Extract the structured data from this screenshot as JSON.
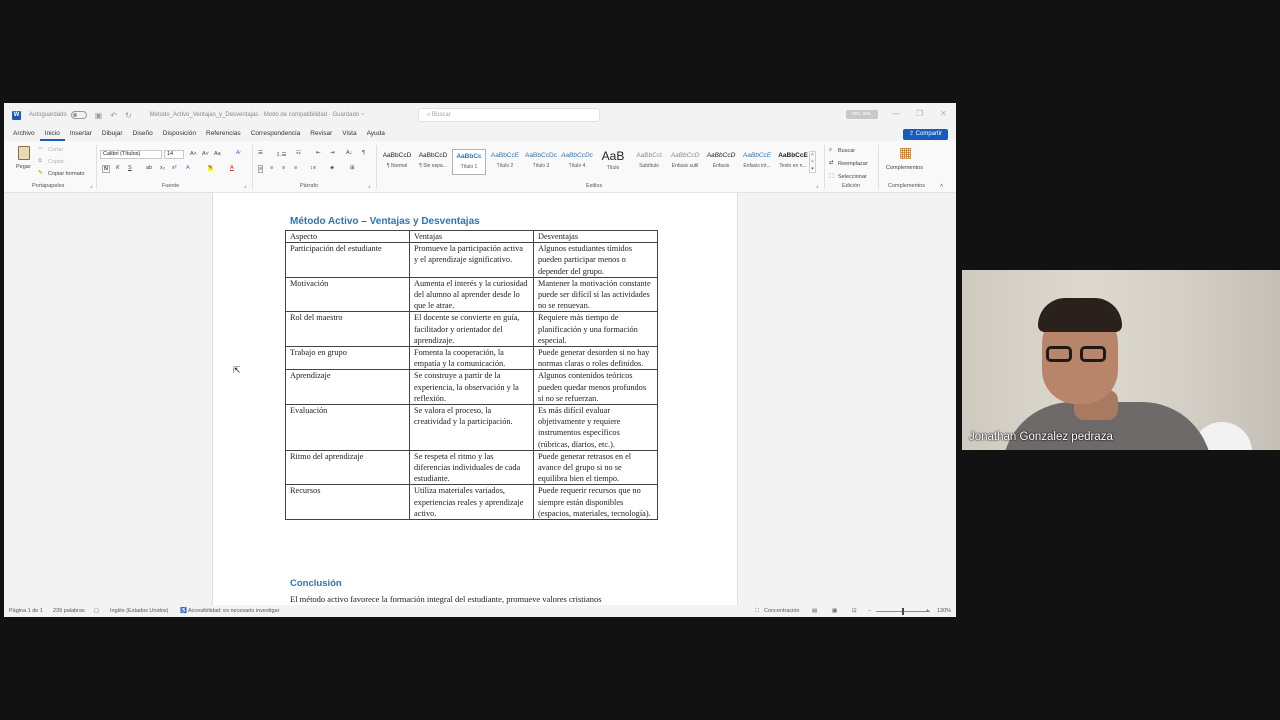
{
  "titlebar": {
    "autosave_label": "Autoguardado",
    "doc_title": "Metodo_Activo_Ventajas_y_Desventajas · Modo de compatibilidad · Guardado ~",
    "search_placeholder": "Buscar",
    "user_badge": "Inic. ses."
  },
  "menu": {
    "tabs": [
      "Archivo",
      "Inicio",
      "Insertar",
      "Dibujar",
      "Diseño",
      "Disposición",
      "Referencias",
      "Correspondencia",
      "Revisar",
      "Vista",
      "Ayuda"
    ],
    "active": "Inicio",
    "share_label": "Compartir"
  },
  "ribbon": {
    "clipboard": {
      "paste": "Pegar",
      "cut": "Cortar",
      "copy": "Copiar",
      "format_painter": "Copiar formato",
      "label": "Portapapeles"
    },
    "font": {
      "family": "Calibri (Títulos)",
      "size": "14",
      "label": "Fuente",
      "bold": "N",
      "italic": "K",
      "underline": "S"
    },
    "paragraph": {
      "label": "Párrafo"
    },
    "styles": {
      "label": "Estilos",
      "items": [
        {
          "sample": "AaBbCcD",
          "name": "¶ Normal"
        },
        {
          "sample": "AaBbCcD",
          "name": "¶ Sin espa..."
        },
        {
          "sample": "AaBbCc",
          "name": "Título 1"
        },
        {
          "sample": "AaBbCcE",
          "name": "Título 2"
        },
        {
          "sample": "AaBbCcDc",
          "name": "Título 3"
        },
        {
          "sample": "AaBbCcDc",
          "name": "Título 4"
        },
        {
          "sample": "AaB",
          "name": "Título"
        },
        {
          "sample": "AaBbCcl",
          "name": "Subtítulo"
        },
        {
          "sample": "AaBbCcD",
          "name": "Énfasis sutil"
        },
        {
          "sample": "AaBbCcD",
          "name": "Énfasis"
        },
        {
          "sample": "AaBbCcE",
          "name": "Énfasis int..."
        },
        {
          "sample": "AaBbCcE",
          "name": "Texto en n..."
        }
      ]
    },
    "editing": {
      "find": "Buscar",
      "replace": "Reemplazar",
      "select": "Seleccionar",
      "label": "Edición"
    },
    "addins": {
      "button": "Complementos",
      "label": "Complementos"
    }
  },
  "document": {
    "title": "Método Activo – Ventajas y Desventajas",
    "table": {
      "headers": [
        "Aspecto",
        "Ventajas",
        "Desventajas"
      ],
      "rows": [
        [
          "Participación del estudiante",
          "Promueve la participación activa y el aprendizaje significativo.",
          "Algunos estudiantes tímidos pueden participar menos o depender del grupo."
        ],
        [
          "Motivación",
          "Aumenta el interés y la curiosidad del alumno al aprender desde lo que le atrae.",
          "Mantener la motivación constante puede ser difícil si las actividades no se renuevan."
        ],
        [
          "Rol del maestro",
          "El docente se convierte en guía, facilitador y orientador del aprendizaje.",
          "Requiere más tiempo de planificación y una formación especial."
        ],
        [
          "Trabajo en grupo",
          "Fomenta la cooperación, la empatía y la comunicación.",
          "Puede generar desorden si no hay normas claras o roles definidos."
        ],
        [
          "Aprendizaje",
          "Se construye a partir de la experiencia, la observación y la reflexión.",
          "Algunos contenidos teóricos pueden quedar menos profundos si no se refuerzan."
        ],
        [
          "Evaluación",
          "Se valora el proceso, la creatividad y la participación.",
          "Es más difícil evaluar objetivamente y requiere instrumentos específicos (rúbricas, diarios, etc.)."
        ],
        [
          "Ritmo del aprendizaje",
          "Se respeta el ritmo y las diferencias individuales de cada estudiante.",
          "Puede generar retrasos en el avance del grupo si no se equilibra bien el tiempo."
        ],
        [
          "Recursos",
          "Utiliza materiales variados, experiencias reales y aprendizaje activo.",
          "Puede requerir recursos que no siempre están disponibles (espacios, materiales, tecnología)."
        ]
      ]
    },
    "conclusion_title": "Conclusión",
    "conclusion_text": "El método activo favorece la formación integral del estudiante, promueve valores cristianos"
  },
  "statusbar": {
    "page": "Página 1 de 1",
    "words": "239 palabras",
    "language": "Inglés (Estados Unidos)",
    "accessibility": "Accesibilidad: es necesario investigar",
    "focus": "Concentración",
    "zoom": "130%"
  },
  "video": {
    "participant_name": "Jonathan Gonzalez pedraza"
  }
}
